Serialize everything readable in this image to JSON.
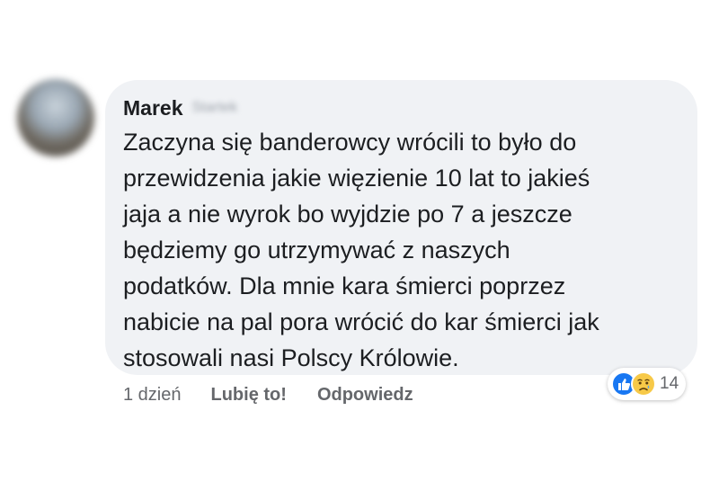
{
  "comment": {
    "author_first_name": "Marek",
    "author_last_name": "Startek",
    "lines": [
      "Zaczyna się banderowcy wrócili to było do",
      "przewidzenia jakie więzienie 10 lat to jakieś",
      "jaja a nie wyrok bo wyjdzie po 7 a jeszcze",
      "będziemy go utrzymywać z naszych",
      "podatków. Dla mnie kara śmierci poprzez",
      "nabicie na pal pora wrócić do kar śmierci jak",
      "stosowali nasi Polscy Królowie."
    ]
  },
  "actions": {
    "time": "1 dzień",
    "like_label": "Lubię to!",
    "reply_label": "Odpowiedz"
  },
  "reactions": {
    "icons": [
      "like-icon",
      "sad-icon"
    ],
    "count": "14",
    "like_color": "#1877f2",
    "sad_color": "#f7c948"
  },
  "colors": {
    "bubble_bg": "#f0f2f5",
    "text": "#1c1e21",
    "secondary_text": "#65676b"
  }
}
